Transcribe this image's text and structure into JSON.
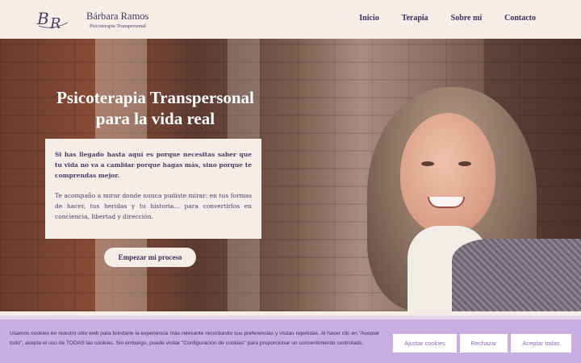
{
  "header": {
    "logo_icon": "br-monogram-logo",
    "brand_name": "Bárbara Ramos",
    "brand_subtitle": "Psicoterapia Transpersonal",
    "nav": [
      {
        "label": "Inicio"
      },
      {
        "label": "Terapia"
      },
      {
        "label": "Sobre mí"
      },
      {
        "label": "Contacto"
      }
    ]
  },
  "hero": {
    "title_line1": "Psicoterapia Transpersonal",
    "title_line2": "para la vida real",
    "lead": "Si has llegado hasta aquí es porque necesitas saber que tu vida no va a cambiar porque hagas más, sino porque te comprendas mejor.",
    "body": "Te acompaño a mirar donde nunca pudiste mirar: en tus formas de hacer, tus heridas y tu historia… para convertirlos en conciencia, libertad y dirección.",
    "cta_label": "Empezar mi proceso"
  },
  "cookie_banner": {
    "text": "Usamos cookies en nuestro sitio web para brindarle la experiencia más relevante recordando sus preferencias y visitas repetidas. Al hacer clic en \"Aceptar todo\", acepta el uso de TODAS las cookies. Sin embargo, puede visitar \"Configuración de cookies\" para proporcionar un consentimiento controlado.",
    "buttons": {
      "settings": "Ajustar cookies",
      "reject": "Rechazar",
      "accept": "Aceptar todas"
    }
  },
  "colors": {
    "header_bg": "#f6ede6",
    "brand_purple": "#4b3a66",
    "cookie_bg": "#c8aee1"
  }
}
